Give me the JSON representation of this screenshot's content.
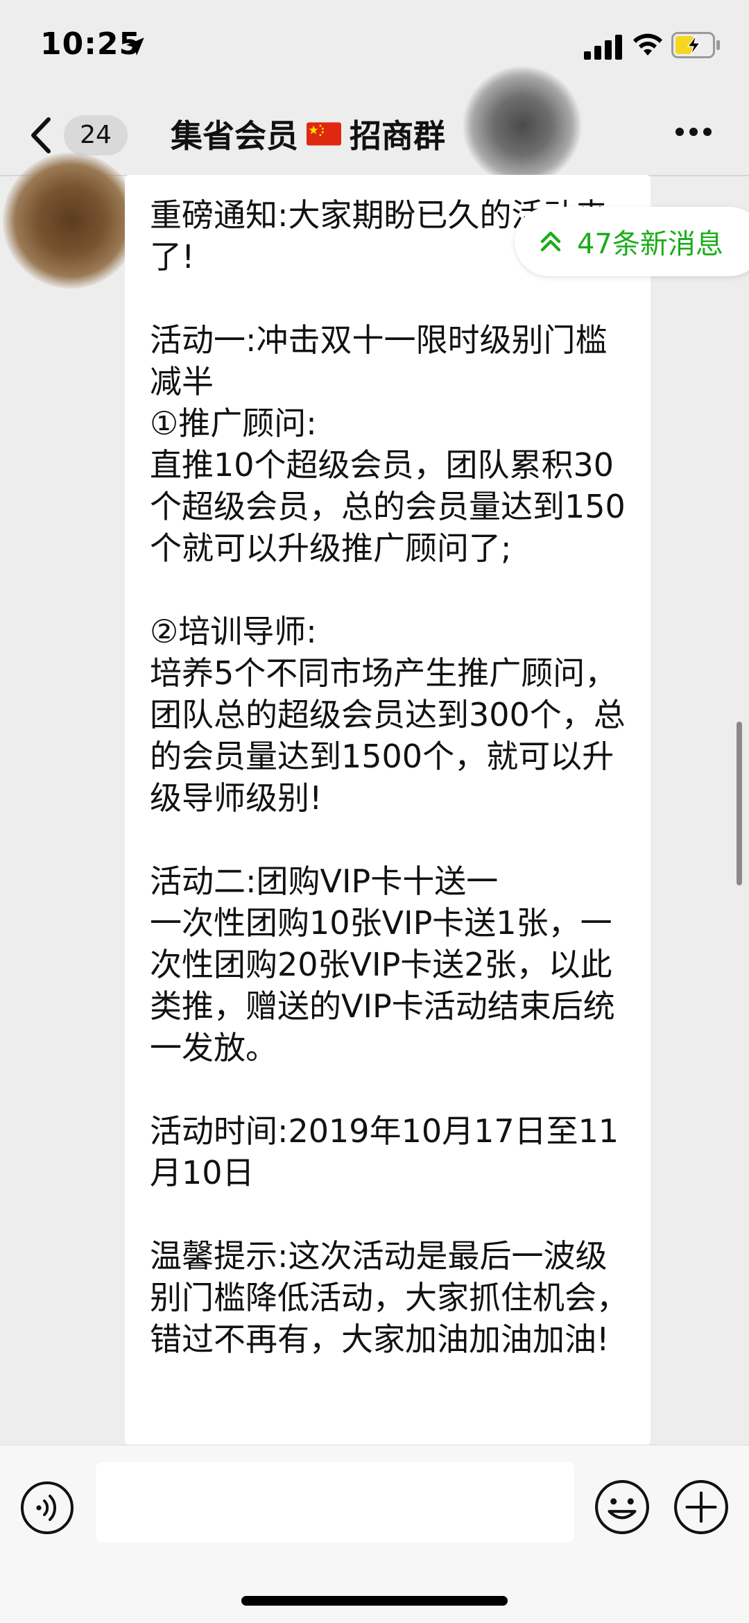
{
  "status_bar": {
    "time": "10:25",
    "location_icon": "location-arrow-icon",
    "signal_icon": "cellular-signal-icon",
    "wifi_icon": "wifi-icon",
    "battery_icon": "battery-charging-icon",
    "battery_color": "#f5d623"
  },
  "nav": {
    "back_icon": "chevron-left-icon",
    "unread_count": "24",
    "title_part1": "集省会员",
    "flag_icon": "china-flag-icon",
    "title_part2": "招商群",
    "more_icon": "more-dots-icon"
  },
  "new_messages": {
    "icon": "double-chevron-up-icon",
    "label": "47条新消息",
    "color": "#1aad19"
  },
  "message": {
    "text": "重磅通知:大家期盼已久的活动来了!\n\n活动一:冲击双十一限时级别门槛减半\n①推广顾问:\n直推10个超级会员，团队累积30个超级会员，总的会员量达到150个就可以升级推广顾问了;\n\n②培训导师:\n培养5个不同市场产生推广顾问，团队总的超级会员达到300个，总的会员量达到1500个，就可以升级导师级别!\n\n活动二:团购VIP卡十送一\n一次性团购10张VIP卡送1张，一次性团购20张VIP卡送2张，以此类推，赠送的VIP卡活动结束后统一发放。\n\n活动时间:2019年10月17日至11月10日\n\n温馨提示:这次活动是最后一波级别门槛降低活动，大家抓住机会，错过不再有，大家加油加油加油!"
  },
  "input_bar": {
    "voice_icon": "voice-input-icon",
    "input_value": "",
    "emoji_icon": "emoji-icon",
    "add_icon": "plus-circle-icon"
  },
  "colors": {
    "background": "#ededed",
    "bubble": "#ffffff",
    "accent_green": "#1aad19"
  }
}
